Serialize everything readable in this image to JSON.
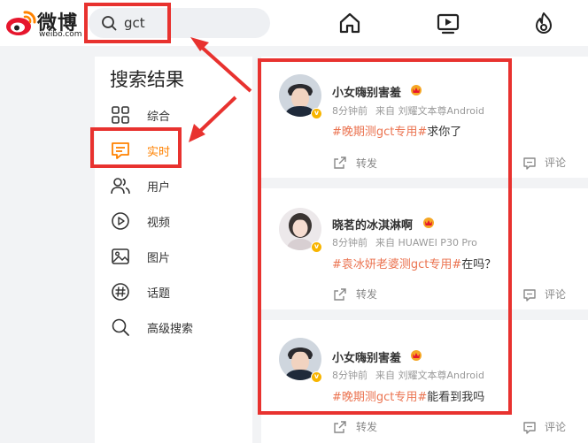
{
  "brand": {
    "name_cn": "微博",
    "name_en": "weibo.com"
  },
  "search": {
    "query": "gct"
  },
  "sidebar": {
    "title": "搜索结果",
    "items": [
      {
        "label": "综合",
        "icon": "grid-icon",
        "active": false
      },
      {
        "label": "实时",
        "icon": "message-icon",
        "active": true
      },
      {
        "label": "用户",
        "icon": "users-icon",
        "active": false
      },
      {
        "label": "视频",
        "icon": "play-circle-icon",
        "active": false
      },
      {
        "label": "图片",
        "icon": "image-icon",
        "active": false
      },
      {
        "label": "话题",
        "icon": "hashtag-icon",
        "active": false
      },
      {
        "label": "高级搜索",
        "icon": "search-icon",
        "active": false
      }
    ]
  },
  "posts": [
    {
      "user": "小女嗨别害羞",
      "time": "8分钟前",
      "source": "来自 刘耀文本尊Android",
      "tag": "#晚期测gct专用#",
      "text": "求你了",
      "repost": "转发",
      "comment": "评论"
    },
    {
      "user": "晓茗的冰淇淋啊",
      "time": "8分钟前",
      "source": "来自 HUAWEI P30 Pro",
      "tag": "#袁冰妍老婆测gct专用#",
      "text": "在吗？",
      "repost": "转发",
      "comment": "评论"
    },
    {
      "user": "小女嗨别害羞",
      "time": "8分钟前",
      "source": "来自 刘耀文本尊Android",
      "tag": "#晚期测gct专用#",
      "text": "能看到我吗",
      "repost": "转发",
      "comment": "评论"
    }
  ],
  "colors": {
    "accent": "#ff8200",
    "topic": "#eb7350",
    "annotation": "#e8322f"
  }
}
